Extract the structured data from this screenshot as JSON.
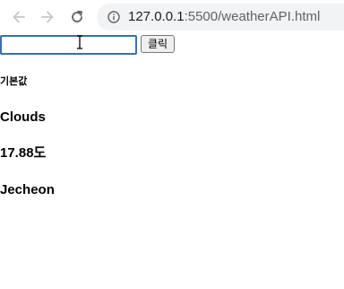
{
  "browser": {
    "url_host": "127.0.0.1",
    "url_path": ":5500/weatherAPI.html"
  },
  "form": {
    "input_value": "",
    "button_label": "클릭"
  },
  "weather": {
    "default_label": "기본값",
    "description": "Clouds",
    "temperature": "17.88",
    "temperature_unit": "도",
    "city": "Jecheon"
  },
  "icons": {
    "back": "arrow-left-icon",
    "forward": "arrow-right-icon",
    "reload": "reload-icon",
    "info": "info-icon",
    "cursor": "text-cursor-icon"
  }
}
